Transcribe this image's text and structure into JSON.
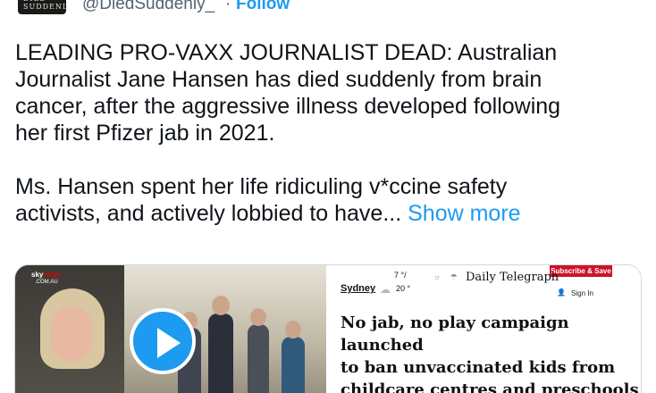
{
  "profile": {
    "avatar_text": "DIED SUDDENLY",
    "handle": "@DiedSuddenly_",
    "separator": "·",
    "follow_label": "Follow"
  },
  "tweet": {
    "paragraph1": "LEADING PRO-VAXX JOURNALIST DEAD: Australian\nJournalist Jane Hansen has died suddenly from brain\ncancer, after the aggressive illness developed following\nher first Pfizer jab in 2021.",
    "paragraph2": "Ms. Hansen spent her life ridiculing v*ccine safety\nactivists, and actively lobbied to have... ",
    "show_more": "Show more"
  },
  "card": {
    "video": {
      "channel": "sky",
      "channel_brand": "news",
      "channel_sub": ".COM.AU",
      "play_icon": "play-icon"
    },
    "article": {
      "city": "Sydney",
      "temp_high": "7 °/",
      "temp_low": "20 °",
      "masthead": "Daily Telegraph",
      "subscribe_label": "Subscribe & Save",
      "signin_icon": "user-icon",
      "signin_label": "Sign In",
      "headline": "No jab, no play campaign launched\nto ban unvaccinated kids from\nchildcare centres and preschools"
    }
  },
  "colors": {
    "link": "#1d9bf0",
    "secondary_text": "#536471",
    "border": "#cfd9de",
    "subscribe": "#cc1428"
  }
}
